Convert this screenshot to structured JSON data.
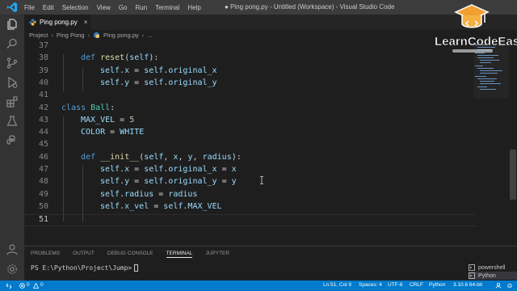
{
  "titlebar": {
    "menu": [
      "File",
      "Edit",
      "Selection",
      "View",
      "Go",
      "Run",
      "Terminal",
      "Help"
    ],
    "window_title": "● Ping pong.py - Untitled (Workspace) - Visual Studio Code"
  },
  "tab": {
    "label": "Ping pong.py",
    "close": "×"
  },
  "breadcrumb": [
    "Project",
    "Ping Pong",
    "Ping pong.py",
    "..."
  ],
  "editor": {
    "lines": [
      {
        "n": "37",
        "segs": []
      },
      {
        "n": "38",
        "segs": [
          [
            "kw",
            "def "
          ],
          [
            "fn",
            "reset"
          ],
          [
            "txt",
            "("
          ],
          [
            "var",
            "self"
          ],
          [
            "txt",
            "):"
          ]
        ]
      },
      {
        "n": "39",
        "segs": [
          [
            "var",
            "self"
          ],
          [
            "txt",
            "."
          ],
          [
            "var",
            "x"
          ],
          [
            "txt",
            " = "
          ],
          [
            "var",
            "self"
          ],
          [
            "txt",
            "."
          ],
          [
            "var",
            "original_x"
          ]
        ]
      },
      {
        "n": "40",
        "segs": [
          [
            "var",
            "self"
          ],
          [
            "txt",
            "."
          ],
          [
            "var",
            "y"
          ],
          [
            "txt",
            " = "
          ],
          [
            "var",
            "self"
          ],
          [
            "txt",
            "."
          ],
          [
            "var",
            "original_y"
          ]
        ]
      },
      {
        "n": "41",
        "segs": []
      },
      {
        "n": "42",
        "segs": [
          [
            "kw",
            "class "
          ],
          [
            "cls",
            "Ball"
          ],
          [
            "txt",
            ":"
          ]
        ]
      },
      {
        "n": "43",
        "segs": [
          [
            "var",
            "MAX_VEL"
          ],
          [
            "txt",
            " = "
          ],
          [
            "num",
            "5"
          ]
        ]
      },
      {
        "n": "44",
        "segs": [
          [
            "var",
            "COLOR"
          ],
          [
            "txt",
            " = "
          ],
          [
            "var",
            "WHITE"
          ]
        ]
      },
      {
        "n": "45",
        "segs": []
      },
      {
        "n": "46",
        "segs": [
          [
            "kw",
            "def "
          ],
          [
            "fn",
            "__init__"
          ],
          [
            "txt",
            "("
          ],
          [
            "var",
            "self"
          ],
          [
            "txt",
            ", "
          ],
          [
            "var",
            "x"
          ],
          [
            "txt",
            ", "
          ],
          [
            "var",
            "y"
          ],
          [
            "txt",
            ", "
          ],
          [
            "var",
            "radius"
          ],
          [
            "txt",
            "):"
          ]
        ]
      },
      {
        "n": "47",
        "segs": [
          [
            "var",
            "self"
          ],
          [
            "txt",
            "."
          ],
          [
            "var",
            "x"
          ],
          [
            "txt",
            " = "
          ],
          [
            "var",
            "self"
          ],
          [
            "txt",
            "."
          ],
          [
            "var",
            "original_x"
          ],
          [
            "txt",
            " = "
          ],
          [
            "var",
            "x"
          ]
        ]
      },
      {
        "n": "48",
        "segs": [
          [
            "var",
            "self"
          ],
          [
            "txt",
            "."
          ],
          [
            "var",
            "y"
          ],
          [
            "txt",
            " = "
          ],
          [
            "var",
            "self"
          ],
          [
            "txt",
            "."
          ],
          [
            "var",
            "original_y"
          ],
          [
            "txt",
            " = "
          ],
          [
            "var",
            "y"
          ]
        ]
      },
      {
        "n": "49",
        "segs": [
          [
            "var",
            "self"
          ],
          [
            "txt",
            "."
          ],
          [
            "var",
            "radius"
          ],
          [
            "txt",
            " = "
          ],
          [
            "var",
            "radius"
          ]
        ]
      },
      {
        "n": "50",
        "segs": [
          [
            "var",
            "self"
          ],
          [
            "txt",
            "."
          ],
          [
            "var",
            "x_vel"
          ],
          [
            "txt",
            " = "
          ],
          [
            "var",
            "self"
          ],
          [
            "txt",
            "."
          ],
          [
            "var",
            "MAX_VEL"
          ]
        ]
      },
      {
        "n": "51",
        "segs": []
      }
    ]
  },
  "panel": {
    "tabs": [
      "PROBLEMS",
      "OUTPUT",
      "DEBUG CONSOLE",
      "TERMINAL",
      "JUPYTER"
    ],
    "active_tab": "TERMINAL",
    "prompt": "PS E:\\Python\\Project\\Jump>",
    "terminals": [
      "powershell",
      "Python"
    ]
  },
  "statusbar": {
    "errors": "0",
    "warnings": "0",
    "position": "Ln 51, Col 9",
    "spaces": "Spaces: 4",
    "encoding": "UTF-8",
    "eol": "CRLF",
    "language": "Python",
    "interpreter": "3.10.6 64-bit"
  },
  "brand": {
    "name": "LearnCodeEasily"
  },
  "colors": {
    "accent": "#007acc",
    "keyword": "#569cd6",
    "function": "#dcdcaa",
    "class": "#4ec9b0",
    "variable": "#9cdcfe",
    "number": "#b5cea8"
  }
}
